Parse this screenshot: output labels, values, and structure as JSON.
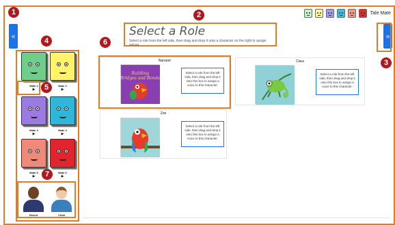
{
  "app": {
    "name": "Tale Mate",
    "header_icons": [
      {
        "icon": "mate-mini-icon",
        "color": "#c6f0c6"
      },
      {
        "icon": "mate-mini-icon",
        "color": "#fff59a"
      },
      {
        "icon": "mate-mini-icon",
        "color": "#a59af0"
      },
      {
        "icon": "mate-mini-icon",
        "color": "#39c0e6"
      },
      {
        "icon": "mate-mini-icon",
        "color": "#f0988a"
      },
      {
        "icon": "mate-mini-icon",
        "color": "#e02b2b"
      }
    ]
  },
  "nav": {
    "prev_label": "«",
    "next_label": "»"
  },
  "header": {
    "title": "Select a Role",
    "subtitle": "Select a role from the left side, then drag and drop it onto a character on the right to assign voices."
  },
  "sidebar": {
    "mates": [
      {
        "name": "Mate 1",
        "play": "▶",
        "color": "#6fcf8a"
      },
      {
        "name": "Mate 2",
        "play": "▶",
        "color": "#fff36b"
      },
      {
        "name": "Mate 3",
        "play": "▶",
        "color": "#9b7be0"
      },
      {
        "name": "Mate 4",
        "play": "▶",
        "color": "#2fb6d8"
      },
      {
        "name": "Mate 5",
        "play": "▶",
        "color": "#ef8a7a"
      },
      {
        "name": "Mate 6",
        "play": "▶",
        "color": "#e0262c"
      }
    ],
    "family": [
      {
        "name": "Parent",
        "skin": "#6b4226",
        "shirt": "#2d3a70"
      },
      {
        "name": "Child",
        "skin": "#f2c9a8",
        "shirt": "#3a7fc0"
      }
    ]
  },
  "characters": [
    {
      "name": "Narrator",
      "image": "book-cover-icon",
      "drop_text": "Select a role from the left side, then drag and drop it onto this box to assign a voice to this character."
    },
    {
      "name": "Clara",
      "image": "chameleon-icon",
      "drop_text": "Select a role from the left side, then drag and drop it onto this box to assign a voice to this character."
    },
    {
      "name": "Zoe",
      "image": "parrot-icon",
      "drop_text": "Select a role from the left side, then drag and drop it onto this box to assign a voice to this character."
    }
  ],
  "annotations": [
    "1",
    "2",
    "3",
    "4",
    "5",
    "6",
    "7"
  ]
}
